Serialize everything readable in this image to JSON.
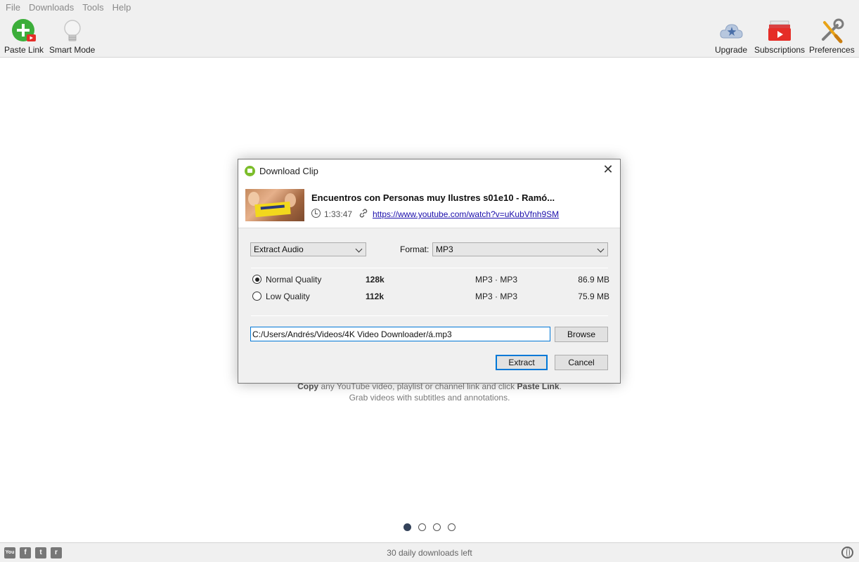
{
  "menu": [
    "File",
    "Downloads",
    "Tools",
    "Help"
  ],
  "toolbar": {
    "paste_link": "Paste Link",
    "smart_mode": "Smart Mode",
    "upgrade": "Upgrade",
    "subscriptions": "Subscriptions",
    "preferences": "Preferences"
  },
  "main": {
    "hint_copy": "Copy",
    "hint_mid": " any YouTube video, playlist or channel link and click ",
    "hint_paste": "Paste Link",
    "hint_end": ".",
    "hint_line2": "Grab videos with subtitles and annotations.",
    "page_dots": 4,
    "active_dot": 0
  },
  "status": {
    "text": "30 daily downloads left",
    "social": [
      "youtube-icon",
      "facebook-icon",
      "twitter-icon",
      "reddit-icon"
    ]
  },
  "dialog": {
    "title": "Download Clip",
    "close": "✕",
    "clip_title": "Encuentros con Personas muy Ilustres s01e10 - Ramó...",
    "duration": "1:33:47",
    "url": "https://www.youtube.com/watch?v=uKubVfnh9SM",
    "mode": "Extract Audio",
    "format_label": "Format:",
    "format_value": "MP3",
    "qualities": [
      {
        "name": "Normal Quality",
        "bitrate": "128k",
        "format": "MP3 · MP3",
        "size": "86.9 MB",
        "selected": true
      },
      {
        "name": "Low Quality",
        "bitrate": "112k",
        "format": "MP3 · MP3",
        "size": "75.9 MB",
        "selected": false
      }
    ],
    "path": "C:/Users/Andrés/Videos/4K Video Downloader/á.mp3",
    "browse": "Browse",
    "extract": "Extract",
    "cancel": "Cancel"
  },
  "colors": {
    "accent_green": "#7cbd2b",
    "focus_blue": "#0078d7",
    "link_blue": "#1a0dab"
  }
}
